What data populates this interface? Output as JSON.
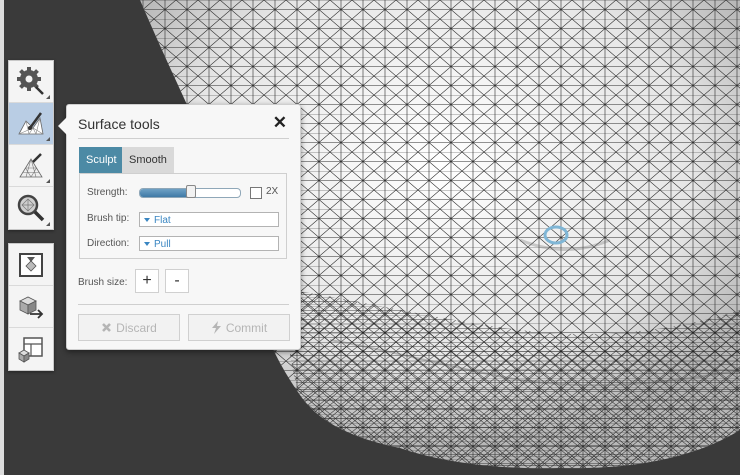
{
  "toolbar": {
    "top_group": [
      "settings-tool",
      "surface-tools",
      "edit-tools",
      "analysis-tools"
    ],
    "bottom_group": [
      "view-tool",
      "export-tool",
      "layout-tool"
    ],
    "active": "surface-tools"
  },
  "panel": {
    "title": "Surface tools",
    "close_glyph": "✕",
    "tabs": [
      {
        "label": "Sculpt",
        "active": true
      },
      {
        "label": "Smooth",
        "active": false
      }
    ],
    "strength_label": "Strength:",
    "strength_value": 0.51,
    "double_label": "2X",
    "double_checked": false,
    "brush_tip_label": "Brush tip:",
    "brush_tip_value": "Flat",
    "direction_label": "Direction:",
    "direction_value": "Pull",
    "brush_size_label": "Brush size:",
    "plus_label": "+",
    "minus_label": "-",
    "discard_label": "Discard",
    "commit_label": "Commit"
  },
  "colors": {
    "background": "#3a3a3a",
    "mesh_surface": "#ededed",
    "mesh_lines": "#2a2a2a",
    "accent_tab": "#4c8aa5",
    "dropdown_text": "#3a86c2",
    "brush_cursor": "#7fb6d6"
  }
}
